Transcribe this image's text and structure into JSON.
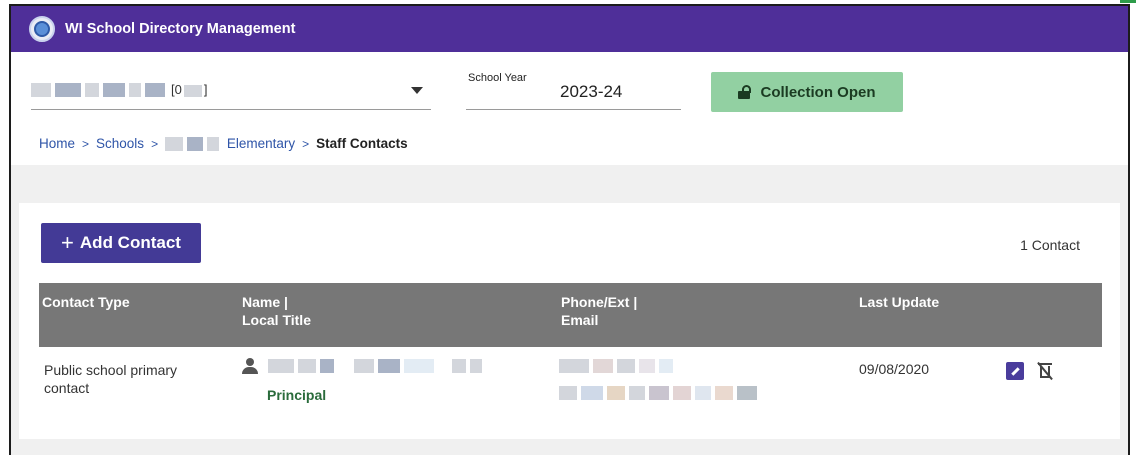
{
  "app": {
    "title": "WI School Directory Management"
  },
  "header": {
    "school_code_suffix": "[0",
    "school_code_end": "]",
    "year_label": "School Year",
    "year_value": "2023-24",
    "status_label": "Collection Open",
    "status_color": "#92d0a2"
  },
  "breadcrumb": {
    "home": "Home",
    "schools": "Schools",
    "school": "Elementary",
    "current": "Staff Contacts",
    "separator": ">"
  },
  "contacts": {
    "add_label": "Add Contact",
    "count_label": "1 Contact",
    "columns": {
      "type": "Contact Type",
      "name_line1": "Name |",
      "name_line2": "Local Title",
      "phone_line1": "Phone/Ext |",
      "phone_line2": "Email",
      "updated": "Last Update"
    },
    "rows": [
      {
        "type": "Public school primary contact",
        "local_title": "Principal",
        "last_update": "09/08/2020"
      }
    ]
  },
  "colors": {
    "brand": "#4f2f99",
    "primary_button": "#433a96",
    "table_header": "#777777",
    "link": "#2f55a8"
  },
  "icons": [
    "app-logo-icon",
    "chevron-down-icon",
    "lock-open-icon",
    "plus-icon",
    "person-icon",
    "edit-icon",
    "trash-disabled-icon"
  ]
}
